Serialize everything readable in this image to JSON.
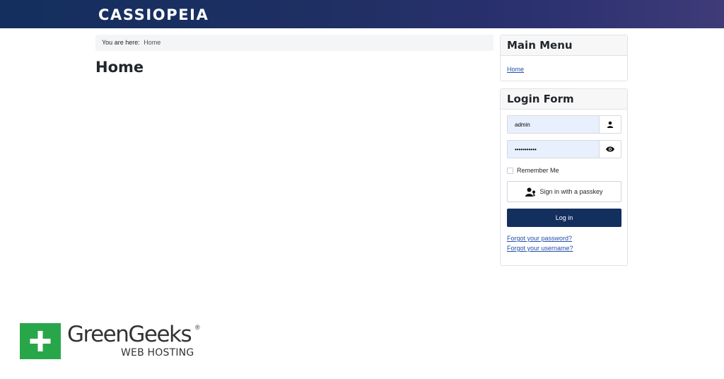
{
  "site": {
    "brand": "CASSIOPEIA"
  },
  "breadcrumb": {
    "prefix": "You are here:",
    "home": "Home"
  },
  "page": {
    "title": "Home"
  },
  "main_menu": {
    "title": "Main Menu",
    "items": [
      {
        "label": "Home"
      }
    ]
  },
  "login_form": {
    "title": "Login Form",
    "username_value": "admin",
    "password_value": "•••••••••••",
    "remember_label": "Remember Me",
    "passkey_label": "Sign in with a passkey",
    "login_label": "Log in",
    "forgot_password": "Forgot your password?",
    "forgot_username": "Forgot your username?",
    "icons": {
      "username": "user-icon",
      "password": "eye-icon",
      "passkey": "user-key-icon"
    }
  },
  "watermark": {
    "name": "GreenGeeks",
    "registered": "®",
    "subtitle": "WEB HOSTING"
  },
  "colors": {
    "header_start": "#132f5e",
    "header_end": "#3e3b78",
    "primary_button": "#132f5e",
    "link": "#224faa",
    "logo_green": "#28a74a"
  }
}
